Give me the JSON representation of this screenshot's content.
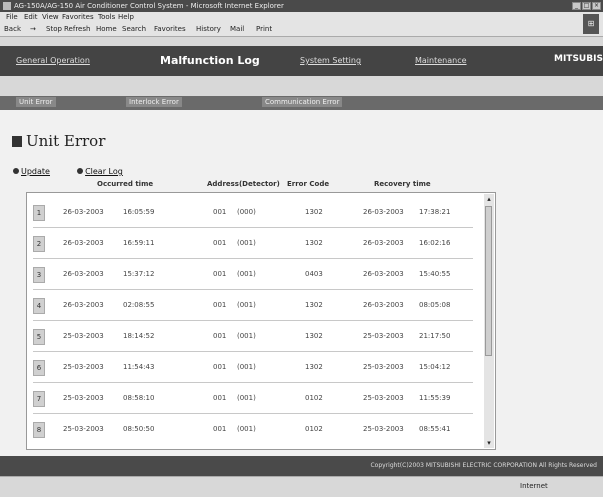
{
  "window": {
    "title": "AG-150A/AG-150 Air Conditioner Control System - Microsoft Internet Explorer",
    "min": "_",
    "max": "□",
    "close": "×"
  },
  "menu": [
    "File",
    "Edit",
    "View",
    "Favorites",
    "Tools",
    "Help"
  ],
  "toolbar": [
    "Back",
    "→",
    "Stop",
    "Refresh",
    "Home",
    "Search",
    "Favorites",
    "History",
    "Mail",
    "Print"
  ],
  "brand_icon": "ms-flag",
  "nav": {
    "left_link": "General Operation",
    "current": "Malfunction Log",
    "link2": "System Setting",
    "link3": "Maintenance",
    "logo": "MITSUBISHI"
  },
  "subnav": [
    "Unit Error",
    "Interlock Error",
    "Communication Error"
  ],
  "page": {
    "title": "Unit Error",
    "update": "Update",
    "clear": "Clear Log"
  },
  "columns": {
    "occurred": "Occurred time",
    "address": "Address(Detector)",
    "code": "Error Code",
    "recovery": "Recovery time"
  },
  "rows": [
    {
      "n": "1",
      "occ_date": "26-03-2003",
      "occ_time": "16:05:59",
      "addr": "001",
      "det": "(000)",
      "code": "1302",
      "rec_date": "26-03-2003",
      "rec_time": "17:38:21"
    },
    {
      "n": "2",
      "occ_date": "26-03-2003",
      "occ_time": "16:59:11",
      "addr": "001",
      "det": "(001)",
      "code": "1302",
      "rec_date": "26-03-2003",
      "rec_time": "16:02:16"
    },
    {
      "n": "3",
      "occ_date": "26-03-2003",
      "occ_time": "15:37:12",
      "addr": "001",
      "det": "(001)",
      "code": "0403",
      "rec_date": "26-03-2003",
      "rec_time": "15:40:55"
    },
    {
      "n": "4",
      "occ_date": "26-03-2003",
      "occ_time": "02:08:55",
      "addr": "001",
      "det": "(001)",
      "code": "1302",
      "rec_date": "26-03-2003",
      "rec_time": "08:05:08"
    },
    {
      "n": "5",
      "occ_date": "25-03-2003",
      "occ_time": "18:14:52",
      "addr": "001",
      "det": "(001)",
      "code": "1302",
      "rec_date": "25-03-2003",
      "rec_time": "21:17:50"
    },
    {
      "n": "6",
      "occ_date": "25-03-2003",
      "occ_time": "11:54:43",
      "addr": "001",
      "det": "(001)",
      "code": "1302",
      "rec_date": "25-03-2003",
      "rec_time": "15:04:12"
    },
    {
      "n": "7",
      "occ_date": "25-03-2003",
      "occ_time": "08:58:10",
      "addr": "001",
      "det": "(001)",
      "code": "0102",
      "rec_date": "25-03-2003",
      "rec_time": "11:55:39"
    },
    {
      "n": "8",
      "occ_date": "25-03-2003",
      "occ_time": "08:50:50",
      "addr": "001",
      "det": "(001)",
      "code": "0102",
      "rec_date": "25-03-2003",
      "rec_time": "08:55:41"
    }
  ],
  "footer": "Copyright(C)2003 MITSUBISHI ELECTRIC CORPORATION All Rights Reserved",
  "status": {
    "zone": "Internet"
  }
}
